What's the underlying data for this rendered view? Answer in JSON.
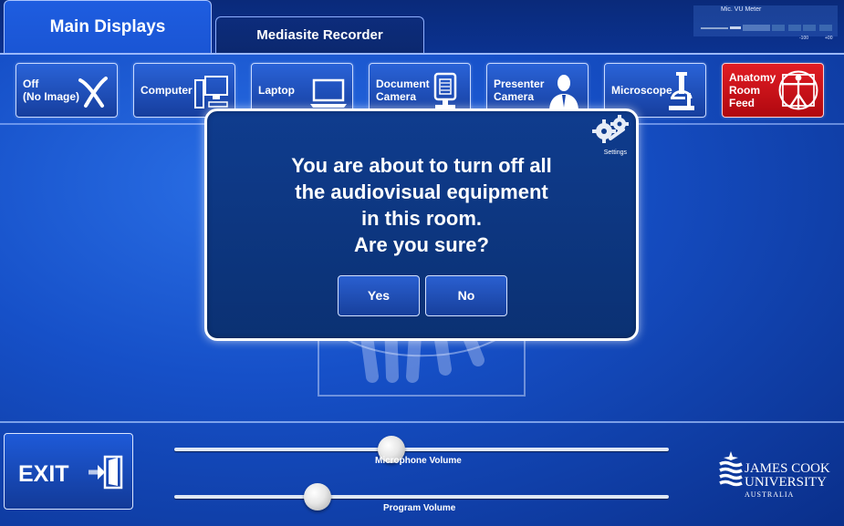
{
  "tabs": [
    {
      "label": "Main Displays",
      "active": true
    },
    {
      "label": "Mediasite Recorder",
      "active": false
    }
  ],
  "vu_meter": {
    "title": "Mic. VU Meter",
    "scale_low": "-100",
    "scale_high": "+00"
  },
  "sources": [
    {
      "label": "Off\n(No Image)",
      "icon": "x-icon"
    },
    {
      "label": "Computer",
      "icon": "computer-icon"
    },
    {
      "label": "Laptop",
      "icon": "laptop-icon"
    },
    {
      "label": "Document\nCamera",
      "icon": "document-camera-icon"
    },
    {
      "label": "Presenter\nCamera",
      "icon": "presenter-icon"
    },
    {
      "label": "Microscope",
      "icon": "microscope-icon"
    },
    {
      "label": "Anatomy\nRoom\nFeed",
      "icon": "vitruvian-man-icon",
      "color": "#d4121a"
    }
  ],
  "dialog": {
    "message_lines": [
      "You are about to turn off all",
      "the audiovisual equipment",
      "in this room.",
      "Are you sure?"
    ],
    "yes_label": "Yes",
    "no_label": "No",
    "settings_label": "Settings"
  },
  "exit_label": "EXIT",
  "sliders": [
    {
      "label": "Microphone Volume",
      "value": 0.44
    },
    {
      "label": "Program Volume",
      "value": 0.29
    }
  ],
  "logo": {
    "line1": "JAMES COOK",
    "line2": "UNIVERSITY",
    "line3": "AUSTRALIA"
  }
}
